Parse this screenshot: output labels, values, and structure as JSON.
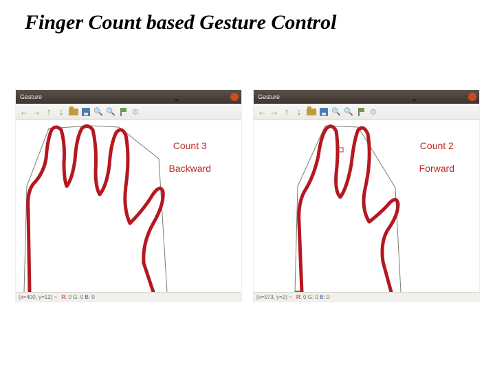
{
  "title": "Finger Count based Gesture Control",
  "panels": {
    "left": {
      "window_title": "Gesture",
      "overlay_line1": "Count 3",
      "overlay_line2": "Backward",
      "status_coords": "(x=400, y=12) ~",
      "status_rgbo": "R: 0 G: 0 B: 0"
    },
    "right": {
      "window_title": "Gesture",
      "overlay_line1": "Count 2",
      "overlay_line2": "Forward",
      "status_coords": "(x=573, y=2) ~",
      "status_rgbo": "R: 0 G: 0 B: 0"
    }
  }
}
